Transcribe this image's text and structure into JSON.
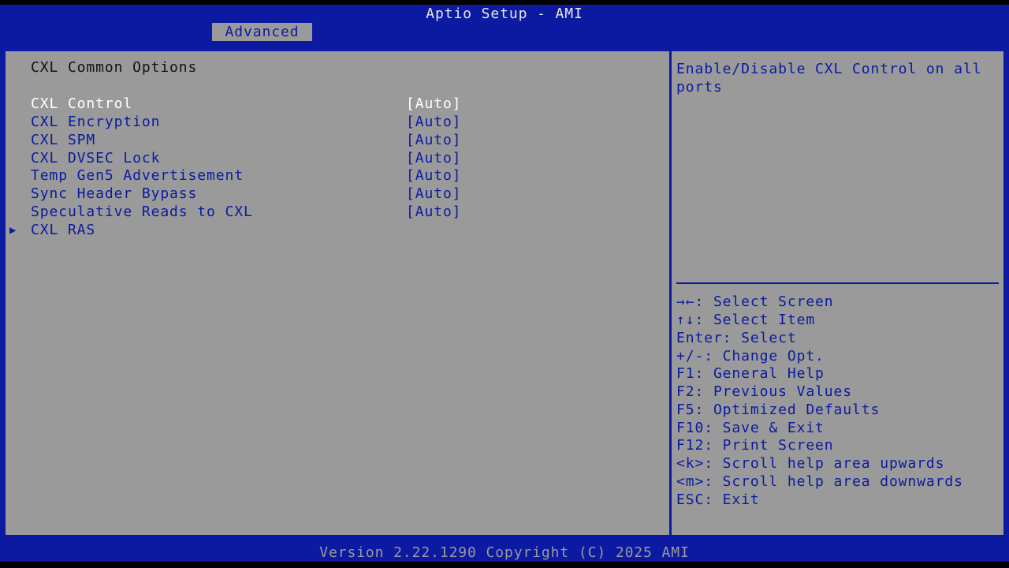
{
  "header": {
    "title": "Aptio Setup - AMI",
    "tab": "Advanced"
  },
  "main": {
    "section_title": "CXL Common Options",
    "items": [
      {
        "label": "CXL Control",
        "value": "[Auto]"
      },
      {
        "label": "CXL Encryption",
        "value": "[Auto]"
      },
      {
        "label": "CXL SPM",
        "value": "[Auto]"
      },
      {
        "label": "CXL DVSEC Lock",
        "value": "[Auto]"
      },
      {
        "label": "Temp Gen5 Advertisement",
        "value": "[Auto]"
      },
      {
        "label": "Sync Header Bypass",
        "value": "[Auto]"
      },
      {
        "label": "Speculative Reads to CXL",
        "value": "[Auto]"
      }
    ],
    "submenu": {
      "label": "CXL RAS",
      "icon": "triangle-right-icon"
    }
  },
  "help": {
    "text": "Enable/Disable CXL Control on all ports",
    "keys": [
      "→←: Select Screen",
      "↑↓: Select Item",
      "Enter: Select",
      "+/-: Change Opt.",
      "F1: General Help",
      "F2: Previous Values",
      "F5: Optimized Defaults",
      "F10: Save & Exit",
      "F12: Print Screen",
      "<k>: Scroll help area upwards",
      "<m>: Scroll help area downwards",
      "ESC: Exit"
    ]
  },
  "footer": {
    "text": "Version 2.22.1290 Copyright (C) 2025 AMI"
  },
  "colors": {
    "accent": "#0b1aa0",
    "background": "#9a9a9a",
    "selected_text": "#ffffff"
  }
}
